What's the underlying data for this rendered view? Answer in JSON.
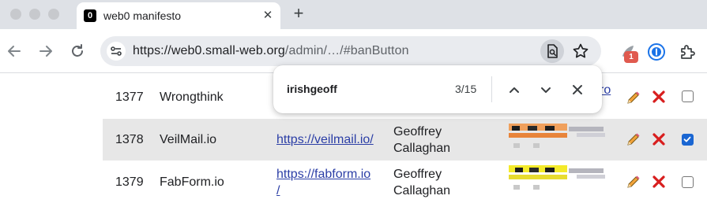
{
  "browser": {
    "tab": {
      "favicon_text": "0",
      "title": "web0 manifesto"
    },
    "address_bar": {
      "url_host": "https://web0.small-web.org",
      "url_path": "/admin/…/#banButton"
    },
    "extension_badge_count": "1"
  },
  "find_bar": {
    "query": "irishgeoff",
    "match_count": "3/15"
  },
  "table": {
    "rows": [
      {
        "id": "1377",
        "name": "Wrongthink",
        "url": "",
        "owner_line1": "",
        "owner_line2": "",
        "partial_link": "ro",
        "checked": false
      },
      {
        "id": "1378",
        "name": "VeilMail.io",
        "url_line1": "https://veilmail.io/",
        "url_line2": "",
        "owner_line1": "Geoffrey",
        "owner_line2": "Callaghan",
        "checked": true
      },
      {
        "id": "1379",
        "name": "FabForm.io",
        "url_line1": "https://fabform.io",
        "url_line2": "/",
        "owner_line1": "Geoffrey",
        "owner_line2": "Callaghan",
        "checked": false
      }
    ]
  },
  "colors": {
    "accent_check": "#1a66d2",
    "delete_red": "#d81e1e",
    "link": "#2b3ea6"
  }
}
